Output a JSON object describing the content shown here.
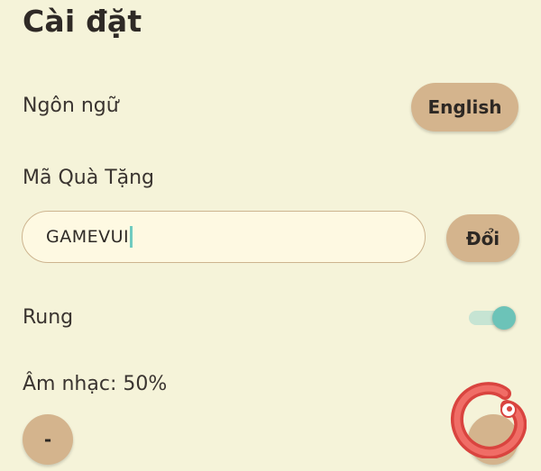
{
  "header": {
    "title": "Cài đặt"
  },
  "language": {
    "label": "Ngôn ngữ",
    "button_label": "English"
  },
  "giftcode": {
    "label": "Mã Quà Tặng",
    "input_value": "GAMEVUI",
    "redeem_label": "Đổi"
  },
  "vibration": {
    "label": "Rung",
    "enabled": true
  },
  "music": {
    "label": "Âm nhạc: 50%",
    "level_percent": 50,
    "decrease_label": "-"
  },
  "colors": {
    "background": "#f5f3d9",
    "button": "#d4b48d",
    "toggle_on": "#6cc3b8",
    "input_background": "#fef9e2"
  },
  "watermark": {
    "icon": "gamevui-logo-icon"
  }
}
